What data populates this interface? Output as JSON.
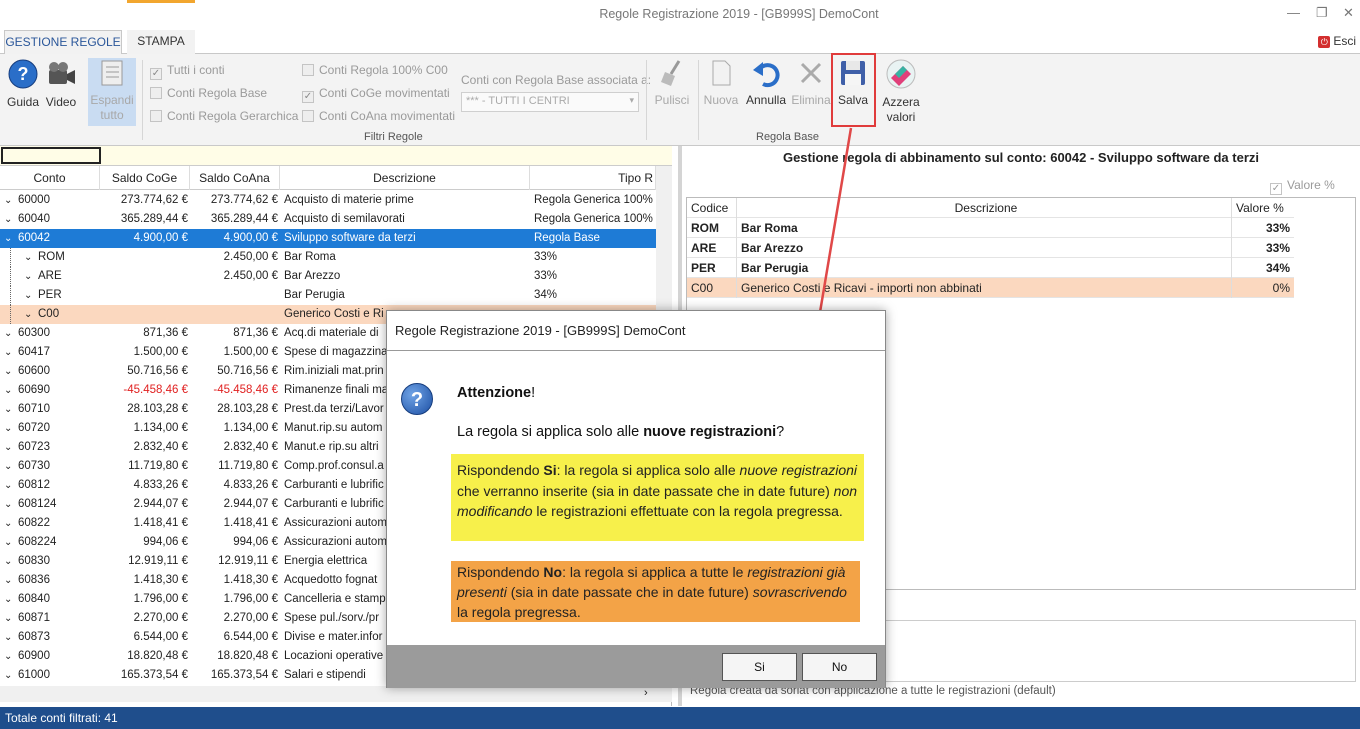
{
  "window": {
    "title": "Regole Registrazione 2019 - [GB999S] DemoCont",
    "minimize": "—",
    "restore": "❐",
    "close": "✕"
  },
  "tabs": [
    {
      "label": "GESTIONE REGOLE"
    },
    {
      "label": "STAMPA"
    }
  ],
  "esci": "Esci",
  "ribbon": {
    "guida": "Guida",
    "video": "Video",
    "espandi": "Espandi tutto",
    "tutti_i_conti": "Tutti i conti",
    "conti_regola_base": "Conti Regola Base",
    "conti_regola_gerarchica": "Conti Regola Gerarchica",
    "conti_regola_100": "Conti Regola 100% C00",
    "conti_coge_mov": "Conti CoGe movimentati",
    "conti_coana_mov": "Conti CoAna movimentati",
    "combo_label": "Conti con Regola Base associata a:",
    "combo_value": "*** - TUTTI I CENTRI",
    "filtri_group": "Filtri Regole",
    "pulisci": "Pulisci",
    "nuova": "Nuova",
    "annulla": "Annulla",
    "elimina": "Elimina",
    "salva": "Salva",
    "azzera": "Azzera valori",
    "regola_base_group": "Regola Base"
  },
  "grid": {
    "columns": [
      "Conto",
      "Saldo CoGe",
      "Saldo CoAna",
      "Descrizione",
      "Tipo R"
    ],
    "rows": [
      {
        "conto": "60000",
        "coge": "273.774,62 €",
        "coana": "273.774,62 €",
        "desc": "Acquisto di materie prime",
        "tipo": "Regola Generica 100%",
        "lvl": 0
      },
      {
        "conto": "60040",
        "coge": "365.289,44 €",
        "coana": "365.289,44 €",
        "desc": "Acquisto di semilavorati",
        "tipo": "Regola Generica 100%",
        "lvl": 0
      },
      {
        "conto": "60042",
        "coge": "4.900,00 €",
        "coana": "4.900,00 €",
        "desc": "Sviluppo software da terzi",
        "tipo": "Regola Base",
        "lvl": 0,
        "sel": true
      },
      {
        "conto": "ROM",
        "coge": "",
        "coana": "2.450,00 €",
        "desc": "Bar Roma",
        "tipo": "33%",
        "lvl": 1
      },
      {
        "conto": "ARE",
        "coge": "",
        "coana": "2.450,00 €",
        "desc": "Bar Arezzo",
        "tipo": "33%",
        "lvl": 1
      },
      {
        "conto": "PER",
        "coge": "",
        "coana": "",
        "desc": "Bar Perugia",
        "tipo": "34%",
        "lvl": 1
      },
      {
        "conto": "C00",
        "coge": "",
        "coana": "",
        "desc": "Generico Costi e Ri",
        "tipo": "",
        "lvl": 1,
        "c00": true
      },
      {
        "conto": "60300",
        "coge": "871,36 €",
        "coana": "871,36 €",
        "desc": "Acq.di materiale di",
        "tipo": "",
        "lvl": 0
      },
      {
        "conto": "60417",
        "coge": "1.500,00 €",
        "coana": "1.500,00 €",
        "desc": "Spese di magazzina",
        "tipo": "",
        "lvl": 0
      },
      {
        "conto": "60600",
        "coge": "50.716,56 €",
        "coana": "50.716,56 €",
        "desc": "Rim.iniziali mat.prin",
        "tipo": "",
        "lvl": 0
      },
      {
        "conto": "60690",
        "coge": "-45.458,46 €",
        "coana": "-45.458,46 €",
        "desc": "Rimanenze finali ma",
        "tipo": "",
        "lvl": 0,
        "neg": true
      },
      {
        "conto": "60710",
        "coge": "28.103,28 €",
        "coana": "28.103,28 €",
        "desc": "Prest.da terzi/Lavor",
        "tipo": "",
        "lvl": 0
      },
      {
        "conto": "60720",
        "coge": "1.134,00 €",
        "coana": "1.134,00 €",
        "desc": "Manut.rip.su autom",
        "tipo": "",
        "lvl": 0
      },
      {
        "conto": "60723",
        "coge": "2.832,40 €",
        "coana": "2.832,40 €",
        "desc": "Manut.e rip.su altri",
        "tipo": "",
        "lvl": 0
      },
      {
        "conto": "60730",
        "coge": "11.719,80 €",
        "coana": "11.719,80 €",
        "desc": "Comp.prof.consul.a",
        "tipo": "",
        "lvl": 0
      },
      {
        "conto": "60812",
        "coge": "4.833,26 €",
        "coana": "4.833,26 €",
        "desc": "Carburanti e lubrific",
        "tipo": "",
        "lvl": 0
      },
      {
        "conto": "608124",
        "coge": "2.944,07 €",
        "coana": "2.944,07 €",
        "desc": "Carburanti e lubrific",
        "tipo": "",
        "lvl": 0
      },
      {
        "conto": "60822",
        "coge": "1.418,41 €",
        "coana": "1.418,41 €",
        "desc": "Assicurazioni autom",
        "tipo": "",
        "lvl": 0
      },
      {
        "conto": "608224",
        "coge": "994,06 €",
        "coana": "994,06 €",
        "desc": "Assicurazioni autom",
        "tipo": "",
        "lvl": 0
      },
      {
        "conto": "60830",
        "coge": "12.919,11 €",
        "coana": "12.919,11 €",
        "desc": "Energia elettrica",
        "tipo": "",
        "lvl": 0
      },
      {
        "conto": "60836",
        "coge": "1.418,30 €",
        "coana": "1.418,30 €",
        "desc": "Acquedotto fognat",
        "tipo": "",
        "lvl": 0
      },
      {
        "conto": "60840",
        "coge": "1.796,00 €",
        "coana": "1.796,00 €",
        "desc": "Cancelleria e stamp",
        "tipo": "",
        "lvl": 0
      },
      {
        "conto": "60871",
        "coge": "2.270,00 €",
        "coana": "2.270,00 €",
        "desc": "Spese pul./sorv./pr",
        "tipo": "",
        "lvl": 0
      },
      {
        "conto": "60873",
        "coge": "6.544,00 €",
        "coana": "6.544,00 €",
        "desc": "Divise e mater.infor",
        "tipo": "",
        "lvl": 0
      },
      {
        "conto": "60900",
        "coge": "18.820,48 €",
        "coana": "18.820,48 €",
        "desc": "Locazioni operative",
        "tipo": "",
        "lvl": 0
      },
      {
        "conto": "61000",
        "coge": "165.373,54 €",
        "coana": "165.373,54 €",
        "desc": "Salari e stipendi",
        "tipo": "",
        "lvl": 0
      }
    ]
  },
  "status": "Totale conti filtrati: 41",
  "right": {
    "title": "Gestione regola di abbinamento sul conto: 60042 - Sviluppo software da terzi",
    "valore_chk": "Valore %",
    "columns": [
      "Codice",
      "Descrizione",
      "Valore %"
    ],
    "rows": [
      {
        "code": "ROM",
        "desc": "Bar Roma",
        "val": "33%",
        "bold": true
      },
      {
        "code": "ARE",
        "desc": "Bar Arezzo",
        "val": "33%",
        "bold": true
      },
      {
        "code": "PER",
        "desc": "Bar Perugia",
        "val": "34%",
        "bold": true
      },
      {
        "code": "C00",
        "desc": "Generico Costi e Ricavi - importi non abbinati",
        "val": "0%",
        "bold": false
      }
    ],
    "footer": "Regola creata da soriat con applicazione a tutte le registrazioni (default)"
  },
  "dialog": {
    "title": "Regole Registrazione 2019 - [GB999S] DemoCont",
    "attenzione": "Attenzione",
    "att_suffix": "!",
    "question_pre": "La regola si applica solo alle ",
    "question_bold": "nuove registrazioni",
    "question_post": "?",
    "si_1": "Rispondendo ",
    "si_2": "Si",
    "si_3": ": la regola si applica solo alle ",
    "si_4": "nuove registrazioni",
    "si_5": " che verranno inserite (sia in date passate che in date future) ",
    "si_6": "non modificando",
    "si_7": " le registrazioni effettuate con la regola pregressa.",
    "no_1": "Rispondendo ",
    "no_2": "No",
    "no_3": ": la regola si applica a tutte le ",
    "no_4": "registrazioni già presenti",
    "no_5": " (sia in date passate che in date future) ",
    "no_6": "sovrascrivendo",
    "no_7": " la regola pregressa.",
    "btn_si": "Si",
    "btn_no": "No"
  },
  "colors": {
    "accent": "#1e7bd6",
    "status_bar": "#1f4e8c",
    "highlight_red": "#e03b3b",
    "yellow_box": "#f7f04b",
    "orange_box": "#f3a347",
    "c00_row": "#fbd8bf"
  }
}
